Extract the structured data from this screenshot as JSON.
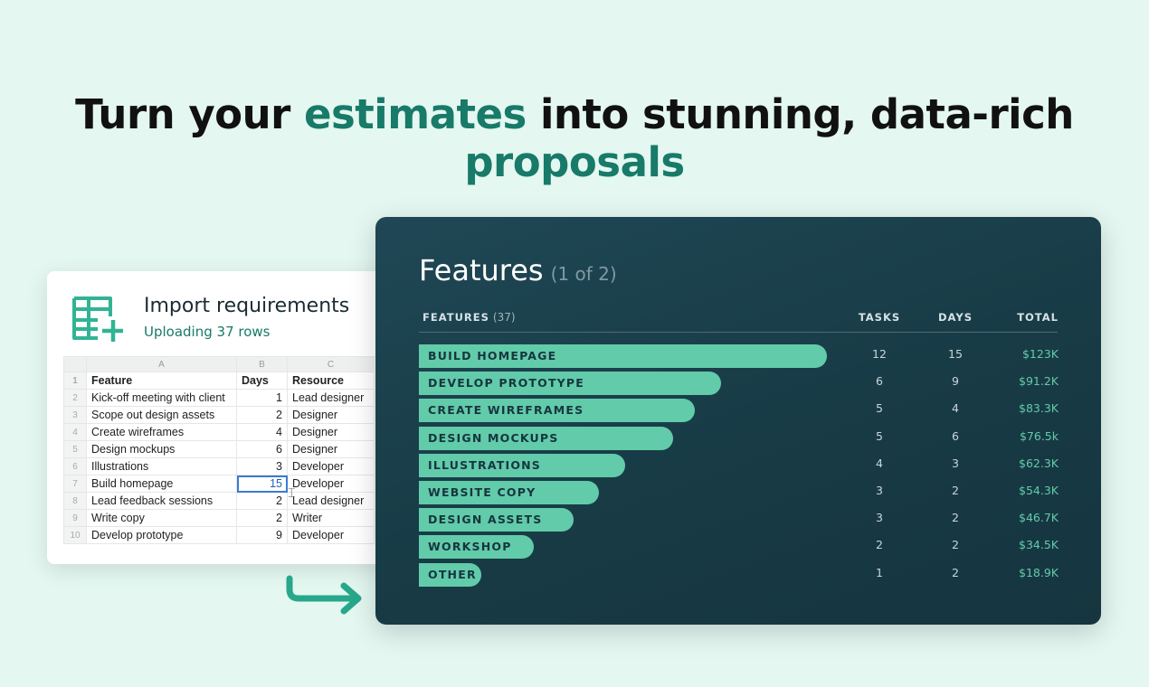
{
  "headline": {
    "part1": "Turn your ",
    "accent1": "estimates",
    "part2": " into stunning, data-rich ",
    "accent2": "proposals"
  },
  "import_card": {
    "title": "Import requirements",
    "subtitle": "Uploading 37 rows",
    "icon": "spreadsheet-add-icon",
    "columns": [
      "A",
      "B",
      "C"
    ],
    "header": {
      "feature": "Feature",
      "days": "Days",
      "resource": "Resource"
    },
    "rows": [
      {
        "n": "2",
        "feature": "Kick-off meeting with client",
        "days": "1",
        "resource": "Lead designer"
      },
      {
        "n": "3",
        "feature": "Scope out design assets",
        "days": "2",
        "resource": "Designer"
      },
      {
        "n": "4",
        "feature": "Create wireframes",
        "days": "4",
        "resource": "Designer"
      },
      {
        "n": "5",
        "feature": "Design mockups",
        "days": "6",
        "resource": "Designer"
      },
      {
        "n": "6",
        "feature": "Illustrations",
        "days": "3",
        "resource": "Developer"
      },
      {
        "n": "7",
        "feature": "Build homepage",
        "days": "15",
        "resource": "Developer"
      },
      {
        "n": "8",
        "feature": "Lead feedback sessions",
        "days": "2",
        "resource": "Lead designer"
      },
      {
        "n": "9",
        "feature": "Write copy",
        "days": "2",
        "resource": "Writer"
      },
      {
        "n": "10",
        "feature": "Develop prototype",
        "days": "9",
        "resource": "Developer"
      }
    ],
    "header_row_number": "1",
    "selected_row": "7"
  },
  "panel": {
    "title": "Features",
    "page": "(1 of 2)",
    "columns": {
      "features": "FEATURES",
      "count": "(37)",
      "tasks": "TASKS",
      "days": "DAYS",
      "total": "TOTAL"
    },
    "accent_color": "#62cba9",
    "rows": [
      {
        "label": "BUILD HOMEPAGE",
        "tasks": "12",
        "days": "15",
        "total": "$123K",
        "value": 123
      },
      {
        "label": "DEVELOP PROTOTYPE",
        "tasks": "6",
        "days": "9",
        "total": "$91.2K",
        "value": 91.2
      },
      {
        "label": "CREATE WIREFRAMES",
        "tasks": "5",
        "days": "4",
        "total": "$83.3K",
        "value": 83.3
      },
      {
        "label": "DESIGN MOCKUPS",
        "tasks": "5",
        "days": "6",
        "total": "$76.5k",
        "value": 76.5
      },
      {
        "label": "ILLUSTRATIONS",
        "tasks": "4",
        "days": "3",
        "total": "$62.3K",
        "value": 62.3
      },
      {
        "label": "WEBSITE COPY",
        "tasks": "3",
        "days": "2",
        "total": "$54.3K",
        "value": 54.3
      },
      {
        "label": "DESIGN ASSETS",
        "tasks": "3",
        "days": "2",
        "total": "$46.7K",
        "value": 46.7
      },
      {
        "label": "WORKSHOP",
        "tasks": "2",
        "days": "2",
        "total": "$34.5K",
        "value": 34.5
      },
      {
        "label": "OTHER",
        "tasks": "1",
        "days": "2",
        "total": "$18.9K",
        "value": 18.9
      }
    ]
  }
}
